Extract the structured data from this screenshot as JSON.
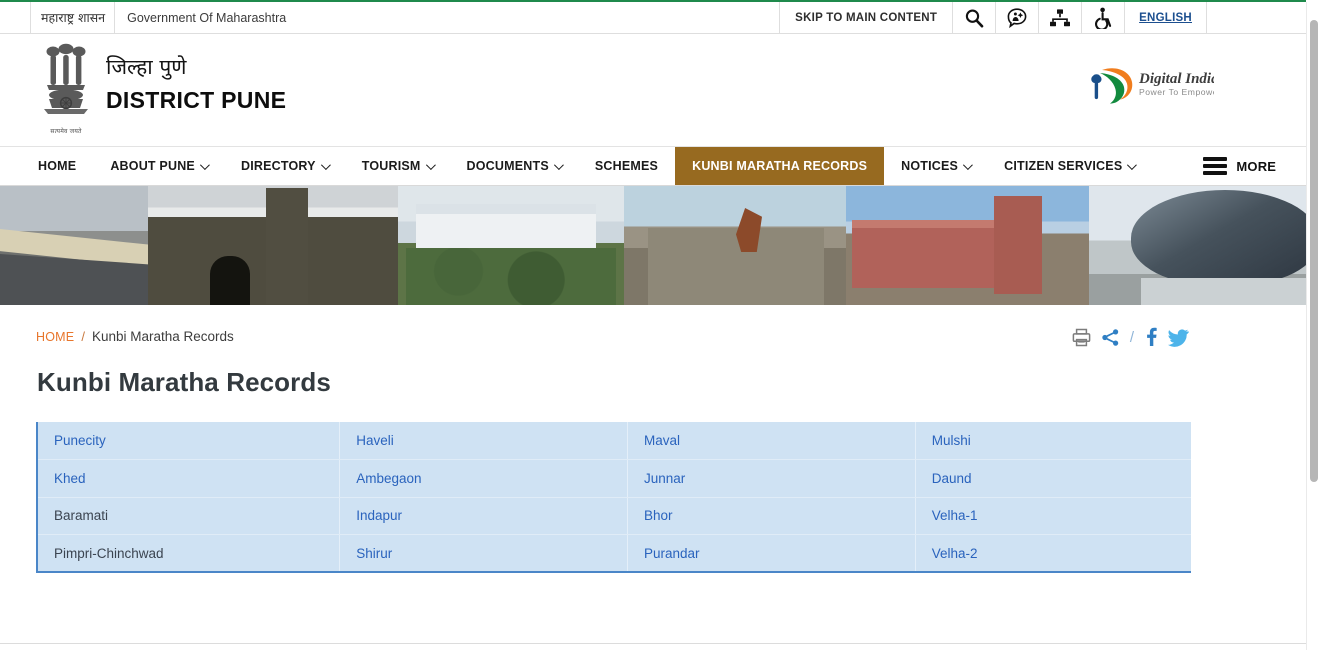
{
  "utility_bar": {
    "state_name_mr": "महाराष्ट्र शासन",
    "state_name_en": "Government Of Maharashtra",
    "skip_link": "SKIP TO MAIN CONTENT",
    "search_icon": "search-icon",
    "accessibility_speech_icon": "speech-bubble-accessibility-icon",
    "sitemap_icon": "sitemap-icon",
    "wheelchair_icon": "wheelchair-accessibility-icon",
    "language": "ENGLISH"
  },
  "header": {
    "emblem_icon": "ashoka-emblem-icon",
    "emblem_motto": "सत्यमेव जयते",
    "title_mr": "जिल्हा पुणे",
    "title_en": "DISTRICT PUNE",
    "digital_india": {
      "name": "Digital India",
      "tagline": "Power To Empower"
    }
  },
  "nav": {
    "items": [
      {
        "label": "HOME",
        "has_caret": false,
        "active": false
      },
      {
        "label": "ABOUT PUNE",
        "has_caret": true,
        "active": false
      },
      {
        "label": "DIRECTORY",
        "has_caret": true,
        "active": false
      },
      {
        "label": "TOURISM",
        "has_caret": true,
        "active": false
      },
      {
        "label": "DOCUMENTS",
        "has_caret": true,
        "active": false
      },
      {
        "label": "SCHEMES",
        "has_caret": false,
        "active": false
      },
      {
        "label": "KUNBI MARATHA RECORDS",
        "has_caret": false,
        "active": true
      },
      {
        "label": "NOTICES",
        "has_caret": true,
        "active": false
      },
      {
        "label": "CITIZEN SERVICES",
        "has_caret": true,
        "active": false
      }
    ],
    "more_label": "MORE",
    "more_icon": "hamburger-menu-icon",
    "active_color": "#976a20"
  },
  "banner": {
    "tiles": [
      "pune-flyover-highway-photo",
      "savitribai-phule-pune-university-building-photo",
      "modern-white-institute-building-photo",
      "shaniwar-wada-with-equestrian-statue-photo",
      "red-brick-heritage-building-photo",
      "glass-dome-modern-building-photo"
    ]
  },
  "breadcrumb": {
    "home": "HOME",
    "separator": "/",
    "current": "Kunbi Maratha Records",
    "home_color": "#e8762c"
  },
  "share": {
    "print_icon": "printer-icon",
    "share_icon": "share-nodes-icon",
    "separator": "/",
    "facebook_icon": "facebook-icon",
    "twitter_icon": "twitter-bird-icon"
  },
  "page": {
    "title": "Kunbi Maratha Records"
  },
  "taluka_table": {
    "background_color": "#cfe2f3",
    "link_color": "#2a63bd",
    "plain_color": "#3b4450",
    "rows": [
      [
        {
          "label": "Punecity",
          "is_link": true
        },
        {
          "label": "Haveli",
          "is_link": true
        },
        {
          "label": "Maval",
          "is_link": true
        },
        {
          "label": "Mulshi",
          "is_link": true
        }
      ],
      [
        {
          "label": "Khed",
          "is_link": true
        },
        {
          "label": "Ambegaon",
          "is_link": true
        },
        {
          "label": "Junnar",
          "is_link": true
        },
        {
          "label": "Daund",
          "is_link": true
        }
      ],
      [
        {
          "label": "Baramati",
          "is_link": false
        },
        {
          "label": "Indapur",
          "is_link": true
        },
        {
          "label": "Bhor",
          "is_link": true
        },
        {
          "label": "Velha-1",
          "is_link": true
        }
      ],
      [
        {
          "label": "Pimpri-Chinchwad",
          "is_link": false
        },
        {
          "label": "Shirur",
          "is_link": true
        },
        {
          "label": "Purandar",
          "is_link": true
        },
        {
          "label": "Velha-2",
          "is_link": true
        }
      ]
    ]
  }
}
